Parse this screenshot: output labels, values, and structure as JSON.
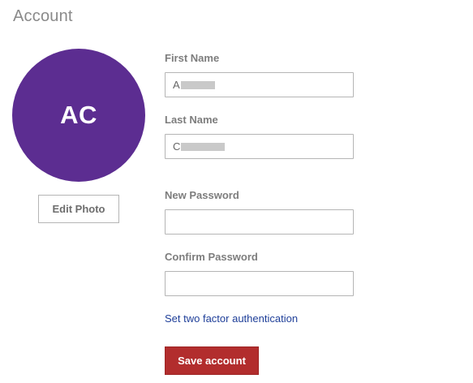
{
  "page": {
    "title": "Account"
  },
  "avatar": {
    "initials": "AC",
    "color": "#5c2d91"
  },
  "edit_photo": {
    "label": "Edit Photo"
  },
  "form": {
    "first_name": {
      "label": "First Name",
      "value": "A"
    },
    "last_name": {
      "label": "Last Name",
      "value": "C"
    },
    "new_password": {
      "label": "New Password",
      "value": ""
    },
    "confirm_password": {
      "label": "Confirm Password",
      "value": ""
    }
  },
  "two_factor_link": {
    "label": "Set two factor authentication"
  },
  "save_button": {
    "label": "Save account",
    "color": "#b22d2d"
  }
}
